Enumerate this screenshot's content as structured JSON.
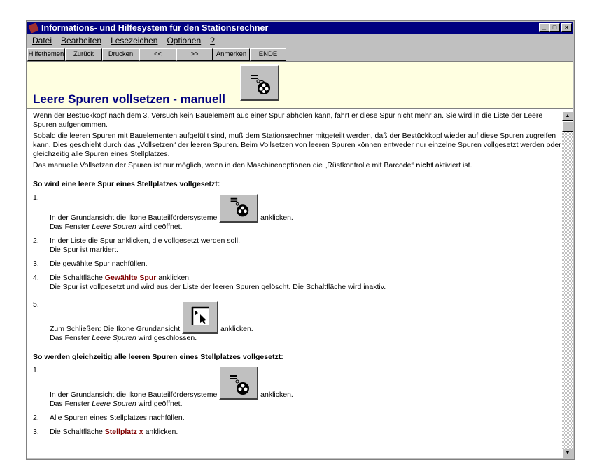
{
  "window": {
    "title": "Informations- und Hilfesystem für den Stationsrechner",
    "min": "_",
    "max": "□",
    "close": "×"
  },
  "menu": [
    "Datei",
    "Bearbeiten",
    "Lesezeichen",
    "Optionen",
    "?"
  ],
  "toolbar": [
    "Hilfethemen",
    "Zurück",
    "Drucken",
    "<<",
    ">>",
    "Anmerken",
    "ENDE"
  ],
  "header": {
    "title": "Leere Spuren vollsetzen - manuell",
    "icon": "feeder-system-icon"
  },
  "intro": [
    "Wenn der Bestückkopf nach dem 3. Versuch kein Bauelement aus einer Spur abholen kann, fährt er diese Spur nicht mehr an. Sie wird in die Liste der Leere Spuren aufgenommen.",
    "Sobald die leeren Spuren mit Bauelementen aufgefüllt sind, muß dem Stationsrechner mitgeteilt werden, daß der Bestückkopf wieder auf diese Spuren zugreifen kann. Dies geschieht durch das „Vollsetzen“ der leeren Spuren. Beim Vollsetzen von leeren Spuren können entweder nur einzelne Spuren vollgesetzt werden oder gleichzeitig alle Spuren eines Stellplatzes."
  ],
  "intro3": {
    "a": "Das manuelle Vollsetzen der Spuren ist nur möglich, wenn in den Maschinenoptionen die „Rüstkontrolle mit Barcode“ ",
    "b": "nicht",
    "c": " aktiviert ist."
  },
  "section1": {
    "heading": "So wird eine leere Spur eines Stellplatzes vollgesetzt:",
    "s1": {
      "n": "1.",
      "a": "In der Grundansicht die Ikone Bauteilfördersysteme",
      "b": "anklicken.",
      "c": "Das Fenster ",
      "d": "Leere Spuren",
      "e": " wird geöffnet."
    },
    "s2": {
      "n": "2.",
      "a": "In der Liste die Spur anklicken, die vollgesetzt werden soll.",
      "b": "Die Spur ist markiert."
    },
    "s3": {
      "n": "3.",
      "a": "Die gewählte Spur nachfüllen."
    },
    "s4": {
      "n": "4.",
      "a": "Die Schaltfläche ",
      "b": "Gewählte Spur",
      "c": " anklicken.",
      "d": "Die Spur ist vollgesetzt und wird aus der Liste der leeren Spuren gelöscht. Die Schaltfläche wird inaktiv."
    },
    "s5": {
      "n": "5.",
      "a": "Zum Schließen: Die Ikone Grundansicht",
      "b": "anklicken.",
      "c": "Das Fenster ",
      "d": "Leere Spuren",
      "e": " wird geschlossen."
    }
  },
  "section2": {
    "heading": "So werden gleichzeitig alle leeren Spuren eines Stellplatzes vollgesetzt:",
    "s1": {
      "n": "1.",
      "a": "In der Grundansicht die Ikone Bauteilfördersysteme",
      "b": "anklicken.",
      "c": "Das Fenster ",
      "d": "Leere Spuren",
      "e": " wird geöffnet."
    },
    "s2": {
      "n": "2.",
      "a": "Alle Spuren eines Stellplatzes nachfüllen."
    },
    "s3": {
      "n": "3.",
      "a": "Die Schaltfläche ",
      "b": "Stellplatz x",
      "c": " anklicken."
    }
  }
}
